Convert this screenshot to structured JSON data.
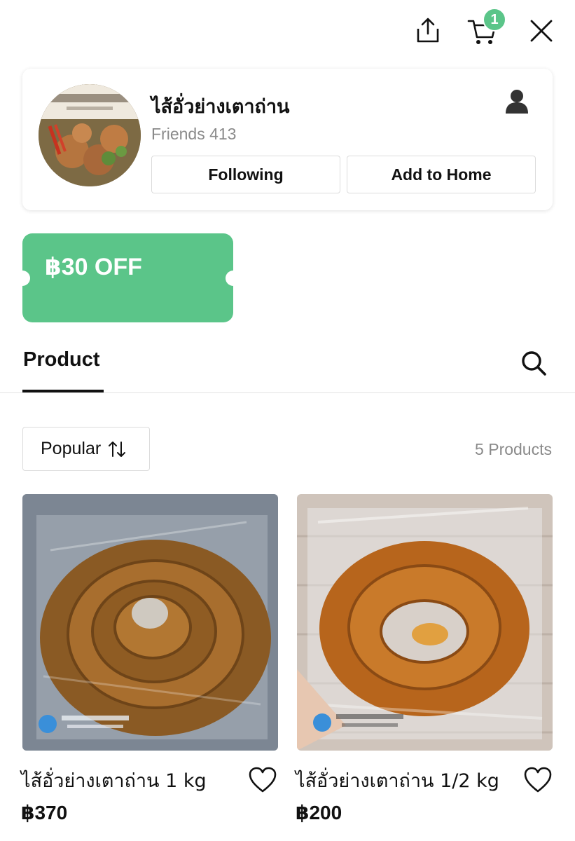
{
  "header": {
    "cart_count": "1",
    "icons": [
      "share-icon",
      "cart-icon",
      "close-icon"
    ]
  },
  "profile": {
    "shop_name": "ไส้อั่วย่างเตาถ่าน",
    "friends": "Friends 413",
    "following_label": "Following",
    "add_home_label": "Add to Home"
  },
  "coupon": {
    "label": "฿30 OFF"
  },
  "tabs": {
    "product_label": "Product"
  },
  "sort": {
    "label": "Popular"
  },
  "product_count": "5 Products",
  "products": [
    {
      "name": "ไส้อั่วย่างเตาถ่าน 1 kg",
      "price": "฿370"
    },
    {
      "name": "ไส้อั่วย่างเตาถ่าน 1/2 kg",
      "price": "฿200"
    }
  ],
  "colors": {
    "accent": "#5bc589",
    "muted": "#8a8a8a"
  }
}
